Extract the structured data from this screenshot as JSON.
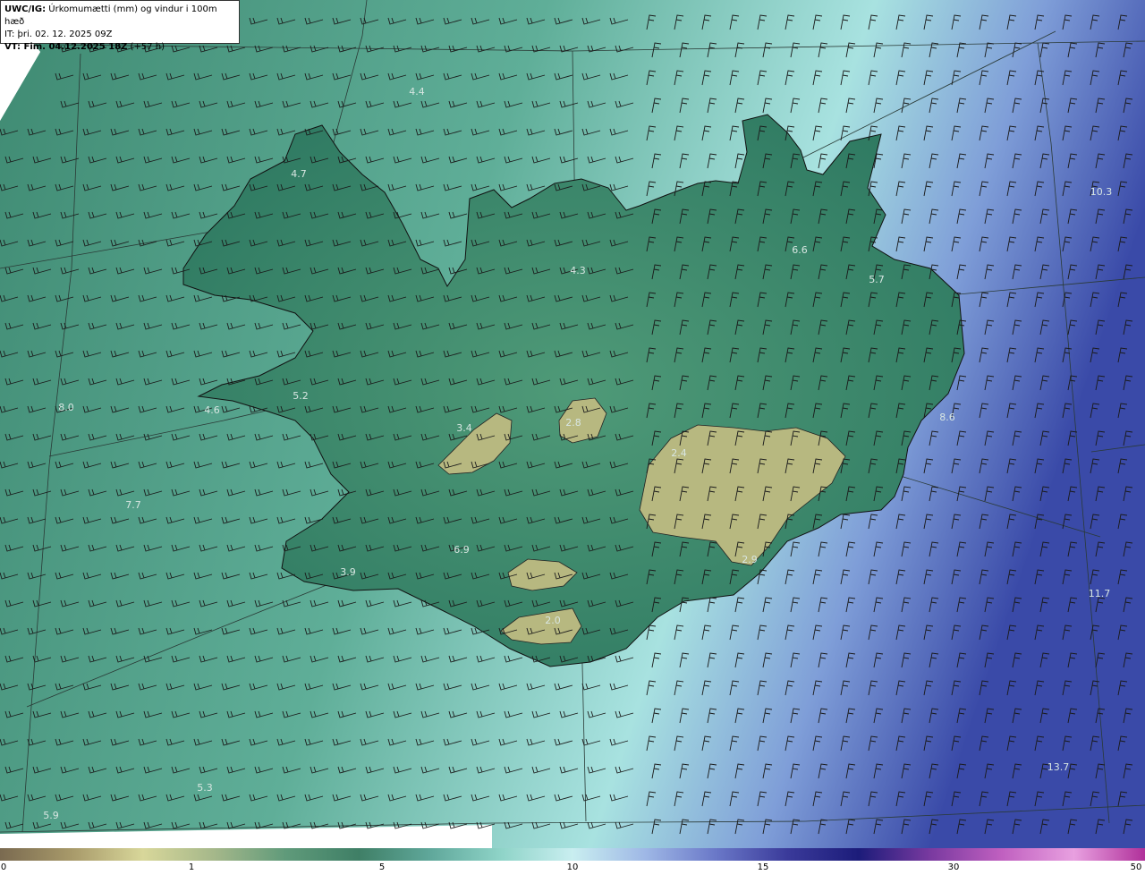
{
  "header": {
    "model_prefix": "UWC/IG:",
    "title_text": " Úrkomumætti (mm) og vindur i 100m hæð",
    "it_line": "IT: þri. 02. 12. 2025 09Z",
    "vt_prefix": "VT: Fim. 04.12.2025 18Z",
    "vt_suffix": " (+57 h)"
  },
  "colorbar": {
    "labels": [
      "0",
      "1",
      "5",
      "10",
      "15",
      "30",
      "50"
    ],
    "colors": [
      "#7a6a50",
      "#a89a6a",
      "#d8d79a",
      "#a4b78a",
      "#5f9a7a",
      "#3f7f66",
      "#5fa79a",
      "#8fd4c8",
      "#c9eef0",
      "#9fb8e6",
      "#6a78c8",
      "#3a3a9a",
      "#1c1c7a",
      "#7a3aa0",
      "#c060c0",
      "#e8a0e0",
      "#b0309a"
    ]
  },
  "map_values": [
    {
      "v": "4.7"
    },
    {
      "v": "4.4"
    },
    {
      "v": "6.6"
    },
    {
      "v": "5.7"
    },
    {
      "v": "4.3"
    },
    {
      "v": "8.0"
    },
    {
      "v": "4.6"
    },
    {
      "v": "5.2"
    },
    {
      "v": "3.4"
    },
    {
      "v": "2.8"
    },
    {
      "v": "2.4"
    },
    {
      "v": "7.7"
    },
    {
      "v": "6.9"
    },
    {
      "v": "3.9"
    },
    {
      "v": "2.9"
    },
    {
      "v": "2.0"
    },
    {
      "v": "11.7"
    },
    {
      "v": "13.7"
    },
    {
      "v": "5.3"
    },
    {
      "v": "5.9"
    },
    {
      "v": "10.3"
    },
    {
      "v": "8.6"
    }
  ]
}
